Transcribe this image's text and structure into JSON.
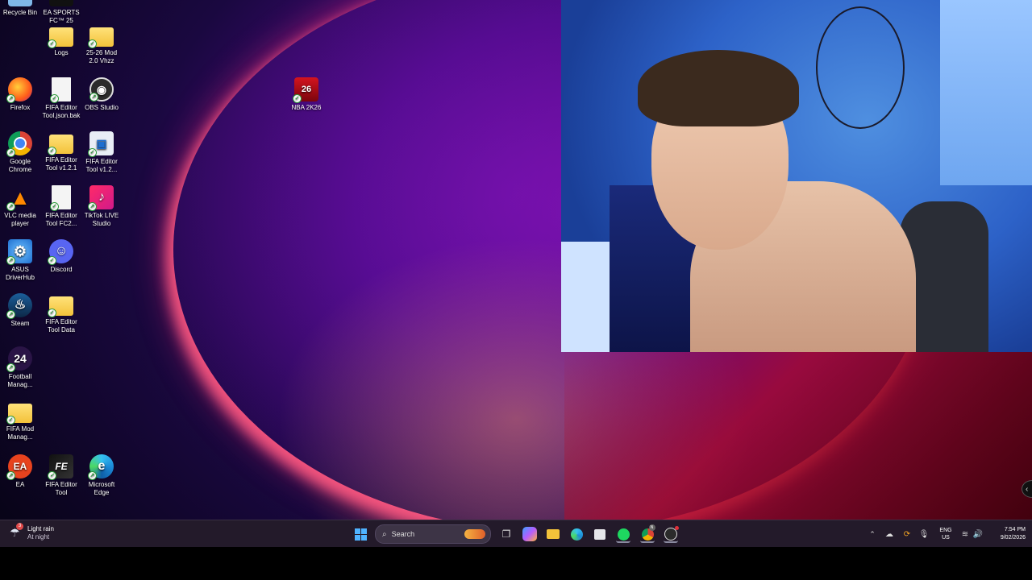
{
  "desktop": {
    "icons": [
      {
        "name": "recycle-bin-icon",
        "label": "Recycle Bin",
        "glyph": "♲",
        "color": "#7fb7e8"
      },
      {
        "name": "ea-sports-fc-icon",
        "label": "EA SPORTS FC™ 25",
        "glyph": "FC",
        "color": "#111111"
      },
      {
        "name": "logs-folder-icon",
        "label": "Logs",
        "glyph": "",
        "color": "#f3c23a"
      },
      {
        "name": "mod-folder-icon",
        "label": "25-26 Mod 2.0 Vhzz",
        "glyph": "",
        "color": "#f3c23a"
      },
      {
        "name": "firefox-icon",
        "label": "Firefox",
        "glyph": "🦊",
        "color": "#ff7a1a"
      },
      {
        "name": "fifa-editor-json-icon",
        "label": "FIFA Editor Tool.json.bak",
        "glyph": "",
        "color": "#f4f4f4"
      },
      {
        "name": "obs-studio-icon",
        "label": "OBS Studio",
        "glyph": "◉",
        "color": "#2b2b2b"
      },
      {
        "name": "google-chrome-icon",
        "label": "Google Chrome",
        "glyph": "◎",
        "color": "#db4437"
      },
      {
        "name": "fifa-editor-v121-folder-icon",
        "label": "FIFA Editor Tool v1.2.1",
        "glyph": "",
        "color": "#f3c23a"
      },
      {
        "name": "fifa-editor-v12-icon",
        "label": "FIFA Editor Tool v1.2...",
        "glyph": "▣",
        "color": "#e9eef6"
      },
      {
        "name": "vlc-icon",
        "label": "VLC media player",
        "glyph": "▲",
        "color": "#ff8800"
      },
      {
        "name": "fifa-editor-fc2-icon",
        "label": "FIFA Editor Tool FC2...",
        "glyph": "",
        "color": "#f4f4f4"
      },
      {
        "name": "tiktok-live-studio-icon",
        "label": "TikTok LIVE Studio",
        "glyph": "♪",
        "color": "#e3245a"
      },
      {
        "name": "asus-driverhub-icon",
        "label": "ASUS DriverHub",
        "glyph": "⚙",
        "color": "#2a8de0"
      },
      {
        "name": "discord-icon",
        "label": "Discord",
        "glyph": "☺",
        "color": "#5865f2"
      },
      {
        "name": "steam-icon",
        "label": "Steam",
        "glyph": "♨",
        "color": "#1b2838"
      },
      {
        "name": "fifa-editor-data-folder-icon",
        "label": "FIFA Editor Tool Data",
        "glyph": "",
        "color": "#f3c23a"
      },
      {
        "name": "football-manager-icon",
        "label": "Football Manag...",
        "glyph": "24",
        "color": "#2a1446"
      },
      {
        "name": "fifa-mod-manager-icon",
        "label": "FIFA Mod Manag...",
        "glyph": "",
        "color": "#f3c23a"
      },
      {
        "name": "ea-icon",
        "label": "EA",
        "glyph": "EA",
        "color": "#e8431e"
      },
      {
        "name": "fifa-editor-tool-icon",
        "label": "FIFA Editor Tool",
        "glyph": "FE",
        "color": "#1b1b1b"
      },
      {
        "name": "microsoft-edge-icon",
        "label": "Microsoft Edge",
        "glyph": "e",
        "color": "#1c8bd8"
      },
      {
        "name": "nba-2k26-icon",
        "label": "NBA 2K26",
        "glyph": "26",
        "color": "#c8101a"
      }
    ]
  },
  "taskbar": {
    "weather_line1": "Light rain",
    "weather_line2": "At night",
    "weather_badge": "3",
    "search_placeholder": "Search",
    "lang_line1": "ENG",
    "lang_line2": "US",
    "time": "7:54 PM",
    "date": "9/02/2026",
    "chrome_badge": "N"
  }
}
